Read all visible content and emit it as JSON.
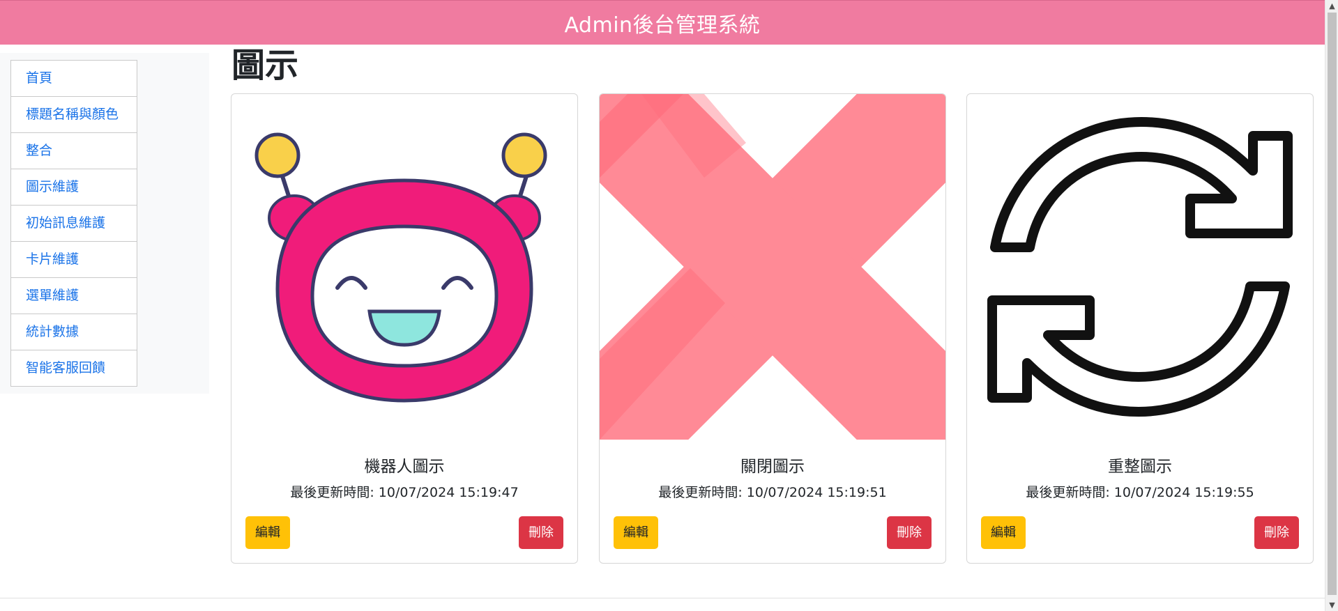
{
  "header": {
    "title": "Admin後台管理系統",
    "color": "#f07ba0"
  },
  "sidebar": {
    "items": [
      {
        "label": "首頁"
      },
      {
        "label": "標題名稱與顏色"
      },
      {
        "label": "整合"
      },
      {
        "label": "圖示維護"
      },
      {
        "label": "初始訊息維護"
      },
      {
        "label": "卡片維護"
      },
      {
        "label": "選單維護"
      },
      {
        "label": "統計數據"
      },
      {
        "label": "智能客服回饋"
      }
    ]
  },
  "main": {
    "title": "圖示",
    "cards": [
      {
        "name": "機器人圖示",
        "updated": "最後更新時間: 10/07/2024 15:19:47",
        "edit_label": "編輯",
        "delete_label": "刪除",
        "icon": "robot-icon"
      },
      {
        "name": "關閉圖示",
        "updated": "最後更新時間: 10/07/2024 15:19:51",
        "edit_label": "編輯",
        "delete_label": "刪除",
        "icon": "close-icon"
      },
      {
        "name": "重整圖示",
        "updated": "最後更新時間: 10/07/2024 15:19:55",
        "edit_label": "編輯",
        "delete_label": "刪除",
        "icon": "refresh-icon"
      }
    ]
  },
  "colors": {
    "edit": "#ffc107",
    "delete": "#dc3545",
    "link": "#1a73e8"
  }
}
